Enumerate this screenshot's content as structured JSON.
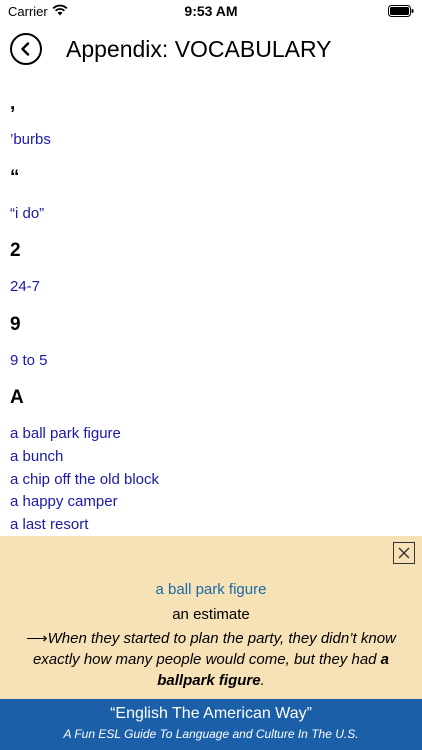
{
  "status_bar": {
    "carrier": "Carrier",
    "time": "9:53 AM"
  },
  "nav": {
    "title": "Appendix: VOCABULARY"
  },
  "sections": [
    {
      "heading": ",",
      "items": [
        "’burbs"
      ]
    },
    {
      "heading": "“",
      "items": [
        "“i do”"
      ]
    },
    {
      "heading": "2",
      "items": [
        "24-7"
      ]
    },
    {
      "heading": "9",
      "items": [
        "9 to 5"
      ]
    },
    {
      "heading": "A",
      "items": [
        "a ball park figure",
        "a bunch",
        "a chip off the old block",
        "a happy camper",
        "a last resort"
      ]
    }
  ],
  "popup": {
    "term": "a ball park figure",
    "definition": "an estimate",
    "example_arrow": "⟶",
    "example_before": "When they started to plan the party, they didn’t know exactly how many people would come, but they had ",
    "example_bold": "a ballpark figure",
    "example_after": "."
  },
  "footer": {
    "title": "“English The American Way”",
    "subtitle": "A Fun ESL Guide To Language and Culture In The U.S."
  },
  "colors": {
    "link": "#1a1aa8",
    "popup_bg": "#f7e1b6",
    "footer_bg": "#1a5fa8",
    "term": "#1a6aa8"
  }
}
